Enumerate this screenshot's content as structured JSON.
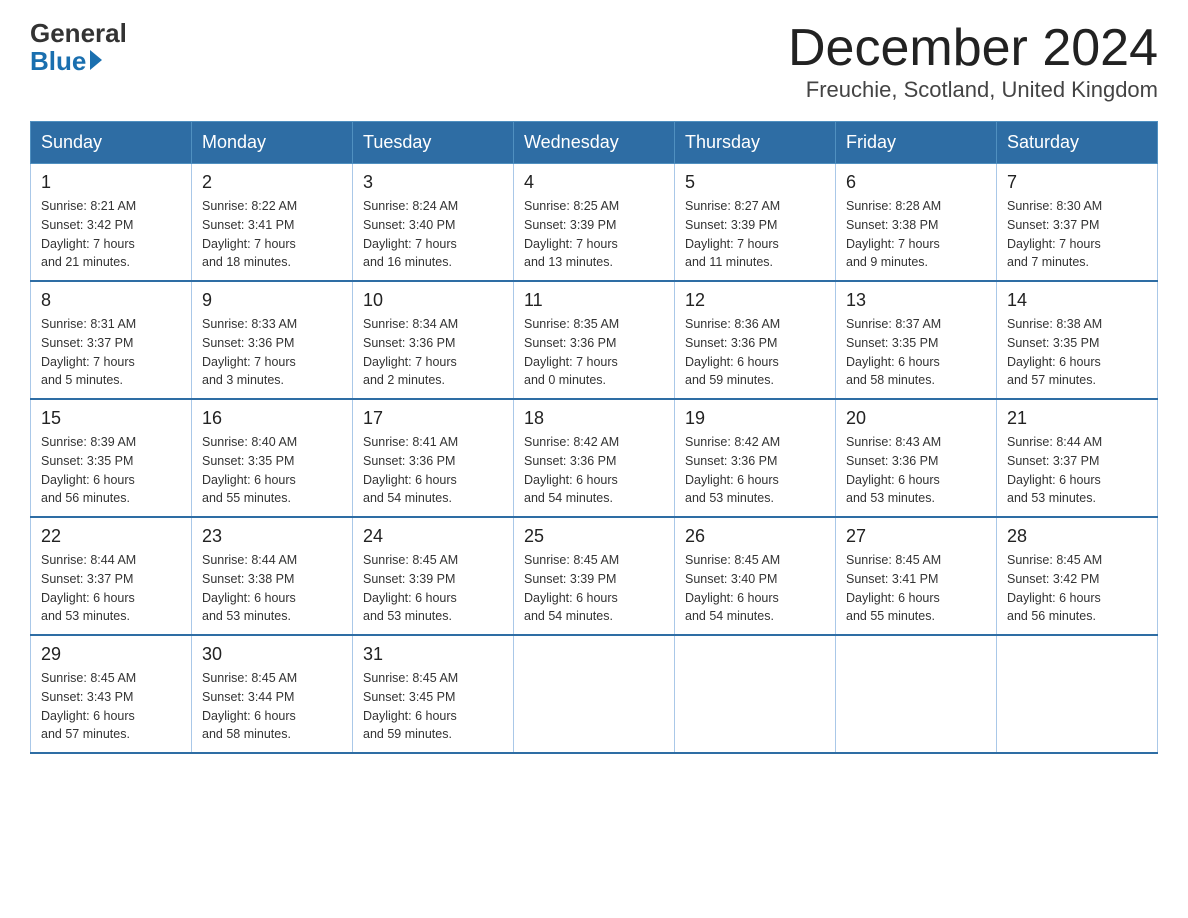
{
  "header": {
    "logo_general": "General",
    "logo_blue": "Blue",
    "month_title": "December 2024",
    "location": "Freuchie, Scotland, United Kingdom"
  },
  "weekdays": [
    "Sunday",
    "Monday",
    "Tuesday",
    "Wednesday",
    "Thursday",
    "Friday",
    "Saturday"
  ],
  "weeks": [
    [
      {
        "day": "1",
        "sunrise": "8:21 AM",
        "sunset": "3:42 PM",
        "daylight": "7 hours and 21 minutes."
      },
      {
        "day": "2",
        "sunrise": "8:22 AM",
        "sunset": "3:41 PM",
        "daylight": "7 hours and 18 minutes."
      },
      {
        "day": "3",
        "sunrise": "8:24 AM",
        "sunset": "3:40 PM",
        "daylight": "7 hours and 16 minutes."
      },
      {
        "day": "4",
        "sunrise": "8:25 AM",
        "sunset": "3:39 PM",
        "daylight": "7 hours and 13 minutes."
      },
      {
        "day": "5",
        "sunrise": "8:27 AM",
        "sunset": "3:39 PM",
        "daylight": "7 hours and 11 minutes."
      },
      {
        "day": "6",
        "sunrise": "8:28 AM",
        "sunset": "3:38 PM",
        "daylight": "7 hours and 9 minutes."
      },
      {
        "day": "7",
        "sunrise": "8:30 AM",
        "sunset": "3:37 PM",
        "daylight": "7 hours and 7 minutes."
      }
    ],
    [
      {
        "day": "8",
        "sunrise": "8:31 AM",
        "sunset": "3:37 PM",
        "daylight": "7 hours and 5 minutes."
      },
      {
        "day": "9",
        "sunrise": "8:33 AM",
        "sunset": "3:36 PM",
        "daylight": "7 hours and 3 minutes."
      },
      {
        "day": "10",
        "sunrise": "8:34 AM",
        "sunset": "3:36 PM",
        "daylight": "7 hours and 2 minutes."
      },
      {
        "day": "11",
        "sunrise": "8:35 AM",
        "sunset": "3:36 PM",
        "daylight": "7 hours and 0 minutes."
      },
      {
        "day": "12",
        "sunrise": "8:36 AM",
        "sunset": "3:36 PM",
        "daylight": "6 hours and 59 minutes."
      },
      {
        "day": "13",
        "sunrise": "8:37 AM",
        "sunset": "3:35 PM",
        "daylight": "6 hours and 58 minutes."
      },
      {
        "day": "14",
        "sunrise": "8:38 AM",
        "sunset": "3:35 PM",
        "daylight": "6 hours and 57 minutes."
      }
    ],
    [
      {
        "day": "15",
        "sunrise": "8:39 AM",
        "sunset": "3:35 PM",
        "daylight": "6 hours and 56 minutes."
      },
      {
        "day": "16",
        "sunrise": "8:40 AM",
        "sunset": "3:35 PM",
        "daylight": "6 hours and 55 minutes."
      },
      {
        "day": "17",
        "sunrise": "8:41 AM",
        "sunset": "3:36 PM",
        "daylight": "6 hours and 54 minutes."
      },
      {
        "day": "18",
        "sunrise": "8:42 AM",
        "sunset": "3:36 PM",
        "daylight": "6 hours and 54 minutes."
      },
      {
        "day": "19",
        "sunrise": "8:42 AM",
        "sunset": "3:36 PM",
        "daylight": "6 hours and 53 minutes."
      },
      {
        "day": "20",
        "sunrise": "8:43 AM",
        "sunset": "3:36 PM",
        "daylight": "6 hours and 53 minutes."
      },
      {
        "day": "21",
        "sunrise": "8:44 AM",
        "sunset": "3:37 PM",
        "daylight": "6 hours and 53 minutes."
      }
    ],
    [
      {
        "day": "22",
        "sunrise": "8:44 AM",
        "sunset": "3:37 PM",
        "daylight": "6 hours and 53 minutes."
      },
      {
        "day": "23",
        "sunrise": "8:44 AM",
        "sunset": "3:38 PM",
        "daylight": "6 hours and 53 minutes."
      },
      {
        "day": "24",
        "sunrise": "8:45 AM",
        "sunset": "3:39 PM",
        "daylight": "6 hours and 53 minutes."
      },
      {
        "day": "25",
        "sunrise": "8:45 AM",
        "sunset": "3:39 PM",
        "daylight": "6 hours and 54 minutes."
      },
      {
        "day": "26",
        "sunrise": "8:45 AM",
        "sunset": "3:40 PM",
        "daylight": "6 hours and 54 minutes."
      },
      {
        "day": "27",
        "sunrise": "8:45 AM",
        "sunset": "3:41 PM",
        "daylight": "6 hours and 55 minutes."
      },
      {
        "day": "28",
        "sunrise": "8:45 AM",
        "sunset": "3:42 PM",
        "daylight": "6 hours and 56 minutes."
      }
    ],
    [
      {
        "day": "29",
        "sunrise": "8:45 AM",
        "sunset": "3:43 PM",
        "daylight": "6 hours and 57 minutes."
      },
      {
        "day": "30",
        "sunrise": "8:45 AM",
        "sunset": "3:44 PM",
        "daylight": "6 hours and 58 minutes."
      },
      {
        "day": "31",
        "sunrise": "8:45 AM",
        "sunset": "3:45 PM",
        "daylight": "6 hours and 59 minutes."
      },
      null,
      null,
      null,
      null
    ]
  ],
  "labels": {
    "sunrise": "Sunrise:",
    "sunset": "Sunset:",
    "daylight": "Daylight:"
  }
}
